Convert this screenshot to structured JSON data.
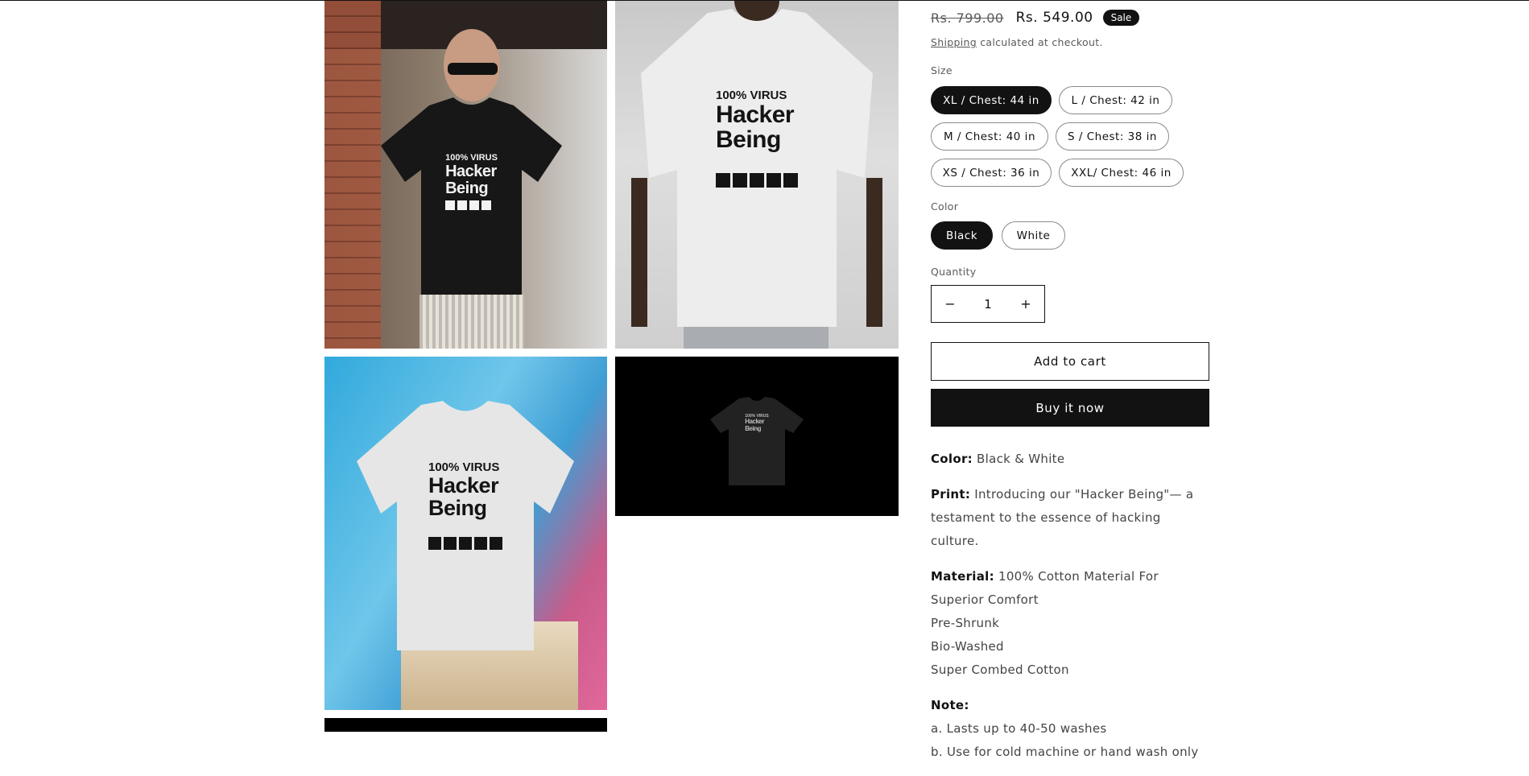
{
  "gallery": {
    "images": [
      {
        "name": "black-tee-model",
        "tee_color": "#171717"
      },
      {
        "name": "white-tee-model",
        "tee_color": "#efefef"
      },
      {
        "name": "white-tee-floating",
        "tee_color": "#e8e8e8"
      },
      {
        "name": "black-tee-dark",
        "tee_color": "#222222"
      }
    ],
    "print": {
      "line1": "100% VIRUS",
      "line2": "Hacker",
      "line3": "Being"
    }
  },
  "product": {
    "price_old": "Rs. 799.00",
    "price_new": "Rs. 549.00",
    "sale_badge": "Sale",
    "shipping_link": "Shipping",
    "shipping_text": " calculated at checkout.",
    "size_label": "Size",
    "sizes": [
      "XL / Chest: 44 in",
      "L / Chest: 42 in",
      "M / Chest: 40 in",
      "S / Chest: 38 in",
      "XS / Chest: 36 in",
      "XXL/ Chest: 46 in"
    ],
    "selected_size": "XL / Chest: 44 in",
    "color_label": "Color",
    "colors": [
      "Black",
      "White"
    ],
    "selected_color": "Black",
    "quantity_label": "Quantity",
    "quantity_value": "1",
    "minus_icon": "minus-icon",
    "plus_icon": "plus-icon",
    "add_to_cart": "Add to cart",
    "buy_now": "Buy it now"
  },
  "description": {
    "color_key": "Color:",
    "color_val": " Black & White",
    "print_key": "Print:",
    "print_val": " Introducing our \"Hacker Being\"— a testament to the essence of hacking culture.",
    "material_key": "Material:",
    "material_val": " 100% Cotton Material For Superior Comfort",
    "features": [
      "Pre-Shrunk",
      "Bio-Washed",
      "Super Combed Cotton"
    ],
    "note_key": "Note:",
    "notes": [
      "a. Lasts up to 40-50 washes",
      "b. Use for cold machine or hand wash only"
    ]
  },
  "colors": {
    "accent": "#121212",
    "muted": "#5a5a5a",
    "border": "#8a8a8a"
  }
}
